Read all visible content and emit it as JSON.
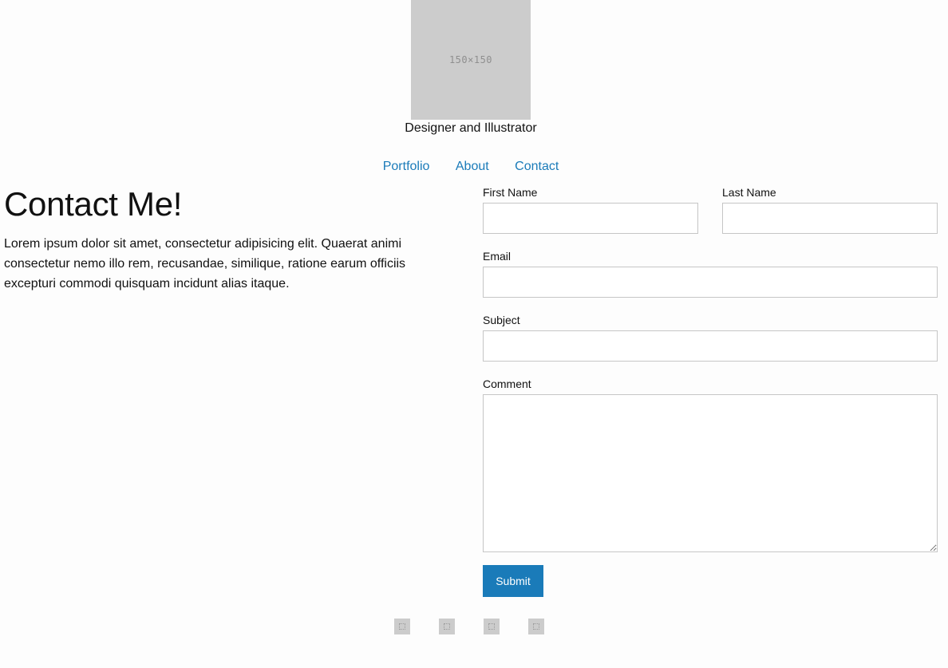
{
  "header": {
    "avatar_placeholder_text": "150×150",
    "tagline": "Designer and Illustrator"
  },
  "nav": {
    "items": [
      {
        "label": "Portfolio"
      },
      {
        "label": "About"
      },
      {
        "label": "Contact"
      }
    ]
  },
  "main": {
    "heading": "Contact Me!",
    "intro": "Lorem ipsum dolor sit amet, consectetur adipisicing elit. Quaerat animi consectetur nemo illo rem, recusandae, similique, ratione earum officiis excepturi commodi quisquam incidunt alias itaque."
  },
  "form": {
    "first_name": {
      "label": "First Name",
      "value": ""
    },
    "last_name": {
      "label": "Last Name",
      "value": ""
    },
    "email": {
      "label": "Email",
      "value": ""
    },
    "subject": {
      "label": "Subject",
      "value": ""
    },
    "comment": {
      "label": "Comment",
      "value": ""
    },
    "submit_label": "Submit"
  },
  "footer": {
    "social_icons": [
      "social-icon-1",
      "social-icon-2",
      "social-icon-3",
      "social-icon-4"
    ]
  },
  "colors": {
    "accent": "#1a7bb9",
    "placeholder_gray": "#cccccc",
    "input_border": "#c6c6c6"
  }
}
